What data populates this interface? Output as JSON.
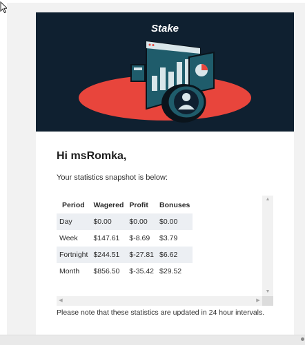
{
  "brand": {
    "logo_text": "Stake"
  },
  "email": {
    "greeting": "Hi msRomka,",
    "intro": "Your statistics snapshot is below:",
    "note": "Please note that these statistics are updated in 24 hour intervals."
  },
  "stats_table": {
    "headers": {
      "period": "Period",
      "wagered": "Wagered",
      "profit": "Profit",
      "bonuses": "Bonuses"
    },
    "rows": [
      {
        "period": "Day",
        "wagered": "$0.00",
        "profit": "$0.00",
        "bonuses": "$0.00"
      },
      {
        "period": "Week",
        "wagered": "$147.61",
        "profit": "$-8.69",
        "bonuses": "$3.79"
      },
      {
        "period": "Fortnight",
        "wagered": "$244.51",
        "profit": "$-27.81",
        "bonuses": "$6.62"
      },
      {
        "period": "Month",
        "wagered": "$856.50",
        "profit": "$-35.42",
        "bonuses": "$29.52"
      }
    ]
  },
  "colors": {
    "hero_background": "#0f2030",
    "accent_red": "#e8453c",
    "teal": "#1f5c6b",
    "zebra_row": "#eceff3"
  },
  "icons": {
    "cursor": "mouse-pointer-icon",
    "scroll_up": "triangle-up-icon",
    "scroll_down": "triangle-down-icon",
    "scroll_left": "triangle-left-icon",
    "scroll_right": "triangle-right-icon"
  }
}
